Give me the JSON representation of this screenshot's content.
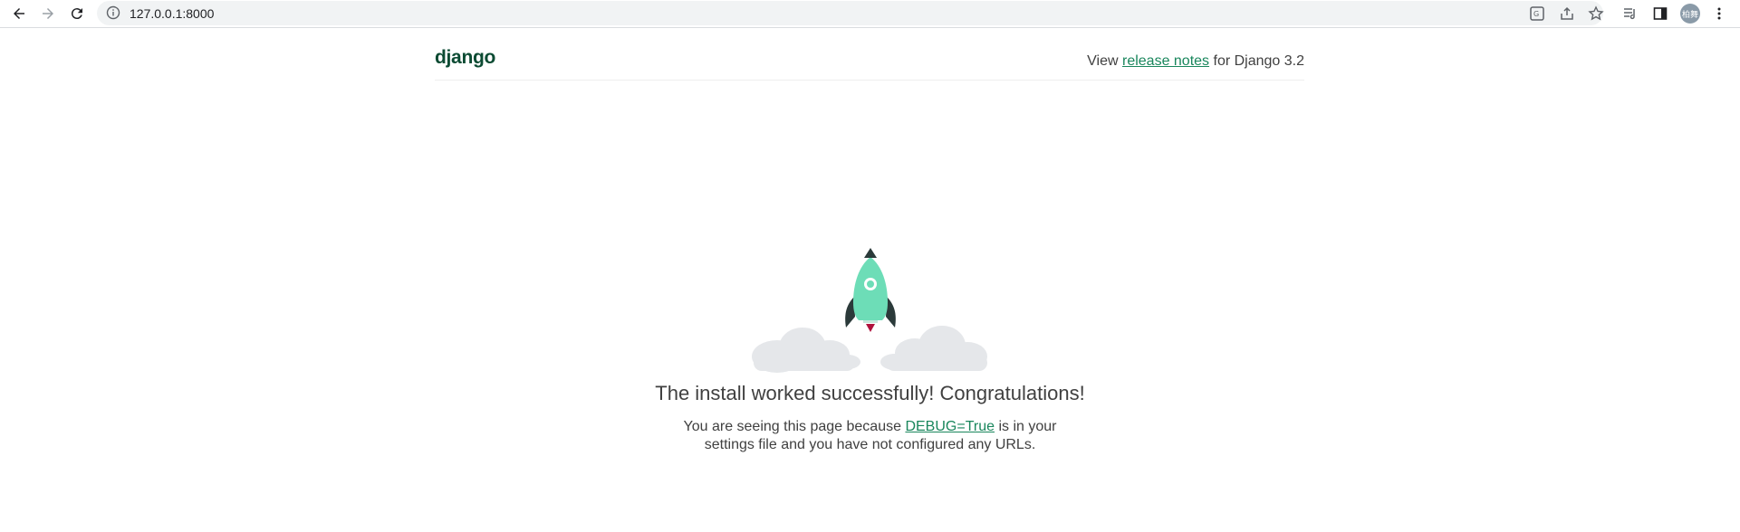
{
  "browser": {
    "url": "127.0.0.1:8000",
    "avatar_label": "柏舞"
  },
  "header": {
    "logo": "django",
    "release_prefix": "View ",
    "release_link": "release notes",
    "release_suffix": " for Django 3.2"
  },
  "main": {
    "title": "The install worked successfully! Congratulations!",
    "desc_prefix": "You are seeing this page because ",
    "desc_link": "DEBUG=True",
    "desc_suffix_line1": " is in your",
    "desc_line2": "settings file and you have not configured any URLs."
  },
  "colors": {
    "brand": "#0c4b33",
    "link": "#19865c",
    "rocket": "#6dddb7",
    "rocket_dark": "#2b3a3a",
    "cloud": "#e5e7ea"
  }
}
